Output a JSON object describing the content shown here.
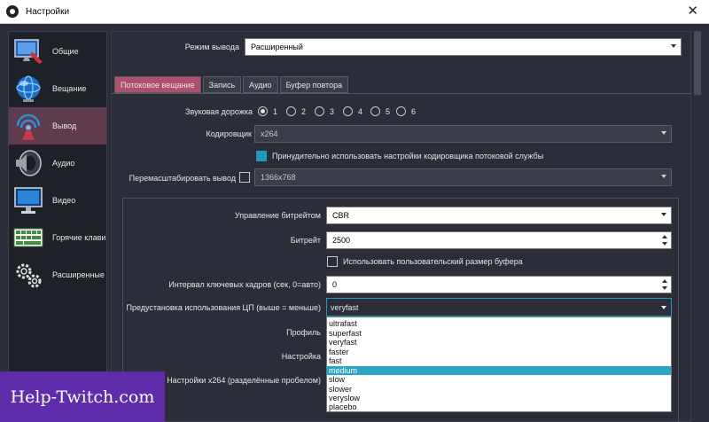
{
  "window": {
    "title": "Настройки",
    "close_glyph": "✕"
  },
  "sidebar": {
    "items": [
      {
        "label": "Общие",
        "icon": "monitor-gear-icon"
      },
      {
        "label": "Вещание",
        "icon": "globe-icon"
      },
      {
        "label": "Вывод",
        "icon": "broadcast-antenna-icon",
        "active": true
      },
      {
        "label": "Аудио",
        "icon": "speaker-icon"
      },
      {
        "label": "Видео",
        "icon": "monitor-icon"
      },
      {
        "label": "Горячие клави",
        "icon": "keyboard-icon"
      },
      {
        "label": "Расширенные",
        "icon": "gears-icon"
      }
    ]
  },
  "output_mode": {
    "label": "Режим вывода",
    "value": "Расширенный"
  },
  "tabs": [
    {
      "label": "Потоковое вещание",
      "active": true
    },
    {
      "label": "Запись"
    },
    {
      "label": "Аудио"
    },
    {
      "label": "Буфер повтора"
    }
  ],
  "audio_track": {
    "label": "Звуковая дорожка",
    "options": [
      "1",
      "2",
      "3",
      "4",
      "5",
      "6"
    ],
    "selected": "1"
  },
  "encoder": {
    "label": "Кодировщик",
    "value": "x264"
  },
  "enforce": {
    "label": "Принудительно использовать настройки кодировщика потоковой службы",
    "checked": true
  },
  "rescale": {
    "label": "Перемасштабировать вывод",
    "value": "1366x768",
    "checked": false
  },
  "rate_control": {
    "label": "Управление битрейтом",
    "value": "CBR"
  },
  "bitrate": {
    "label": "Битрейт",
    "value": "2500"
  },
  "custom_buffer": {
    "label": "Использовать пользовательский размер буфера",
    "checked": false
  },
  "keyframe": {
    "label": "Интервал ключевых кадров (сек, 0=авто)",
    "value": "0"
  },
  "cpu_preset": {
    "label": "Предустановка использования ЦП (выше = меньше)",
    "value": "veryfast",
    "options": [
      "ultrafast",
      "superfast",
      "veryfast",
      "faster",
      "fast",
      "medium",
      "slow",
      "slower",
      "veryslow",
      "placebo"
    ],
    "highlighted": "medium"
  },
  "profile": {
    "label": "Профиль"
  },
  "tune": {
    "label": "Настройка"
  },
  "x264_opts": {
    "label": "Настройки x264 (разделённые пробелом)"
  },
  "watermark": {
    "text": "Help-Twitch.com"
  },
  "colors": {
    "accent": "#b04e6d",
    "selection": "#28a6c4",
    "background": "#2b2e38",
    "watermark": "#5f2cab"
  }
}
